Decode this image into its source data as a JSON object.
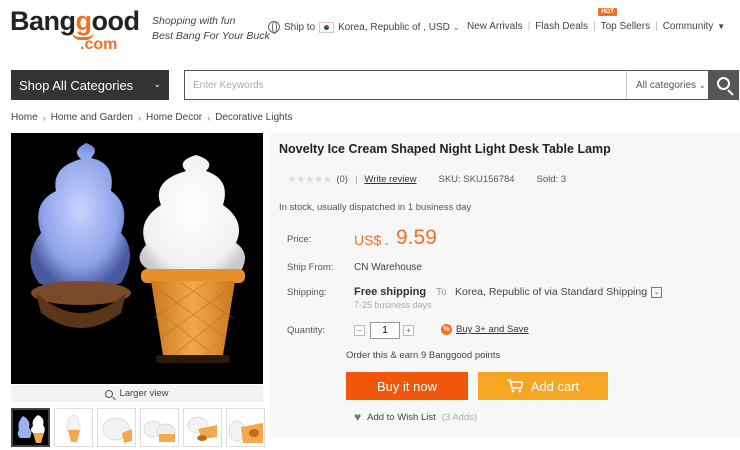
{
  "header": {
    "logo_main": "Bang",
    "logo_g": "g",
    "logo_rest": "ood",
    "logo_domain": ".com",
    "tagline_1": "Shopping with fun",
    "tagline_2": "Best Bang For Your Buck",
    "ship_to_label": "Ship to",
    "ship_to_value": "Korea, Republic of , USD",
    "nav": [
      "New Arrivals",
      "Flash Deals",
      "Top Sellers",
      "Community"
    ],
    "hot_badge": "HOT"
  },
  "search": {
    "category_button": "Shop All Categories",
    "placeholder": "Enter Keywords",
    "category_select": "All categories"
  },
  "breadcrumb": [
    "Home",
    "Home and Garden",
    "Home Decor",
    "Decorative Lights"
  ],
  "gallery": {
    "larger_view": "Larger view"
  },
  "product": {
    "title": "Novelty Ice Cream Shaped Night Light Desk Table Lamp",
    "stars": "★★★★★",
    "review_count": "(0)",
    "write_review": "Write review",
    "sku": "SKU: SKU156784",
    "sold": "Sold: 3",
    "stock": "In stock, usually dispatched in 1 business day",
    "price_label": "Price:",
    "currency": "US$",
    "price": "9.59",
    "ship_from_label": "Ship From:",
    "ship_from": "CN Warehouse",
    "shipping_label": "Shipping:",
    "free_shipping": "Free shipping",
    "to_label": "To",
    "ship_dest": "Korea, Republic of via Standard Shipping",
    "ship_days": "7-25 business days",
    "quantity_label": "Quantity:",
    "quantity": "1",
    "buy3": "Buy 3+ and Save",
    "points": "Order this & earn 9 Banggood points",
    "buy_now": "Buy it now",
    "add_cart": "Add cart",
    "wishlist": "Add to Wish List",
    "wish_count": "(3 Adds)"
  }
}
